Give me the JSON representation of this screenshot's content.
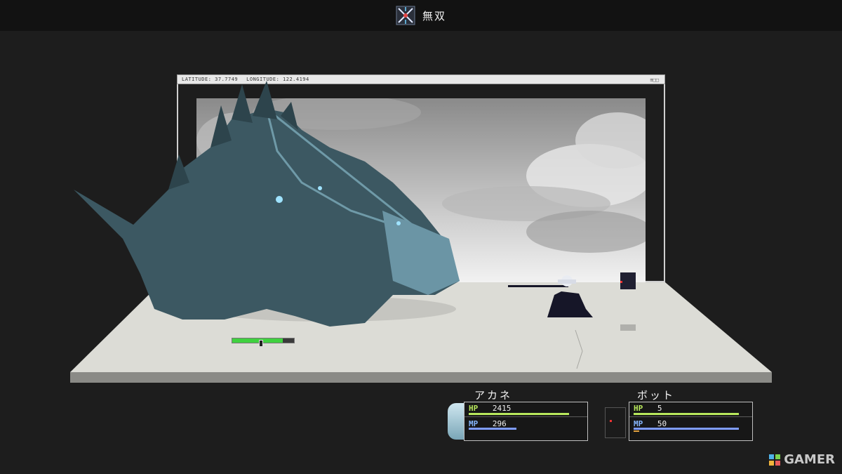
{
  "skill": {
    "name": "無双",
    "icon": "crossed-swords-icon"
  },
  "window": {
    "latitude_label": "LATITUDE: 37.7749",
    "longitude_label": "LONGITUDE: 122.4194",
    "menu_label": "≡□□"
  },
  "enemy": {
    "hp_fraction": 0.82
  },
  "party": [
    {
      "name": "アカネ",
      "hp_label": "HP",
      "hp": "2415",
      "mp_label": "MP",
      "mp": "296",
      "hp_fraction": 0.95,
      "mp_fraction": 0.45
    },
    {
      "name": "ボット",
      "hp_label": "HP",
      "hp": "5",
      "mp_label": "MP",
      "mp": "50",
      "hp_fraction": 1.0,
      "mp_fraction": 1.0
    }
  ],
  "watermark": {
    "text": "GAMER"
  },
  "colors": {
    "hp_bar": "#b8e85c",
    "mp_bar": "#7f9cff",
    "enemy_hp": "#3fd13f",
    "accent_red": "#e33333"
  }
}
